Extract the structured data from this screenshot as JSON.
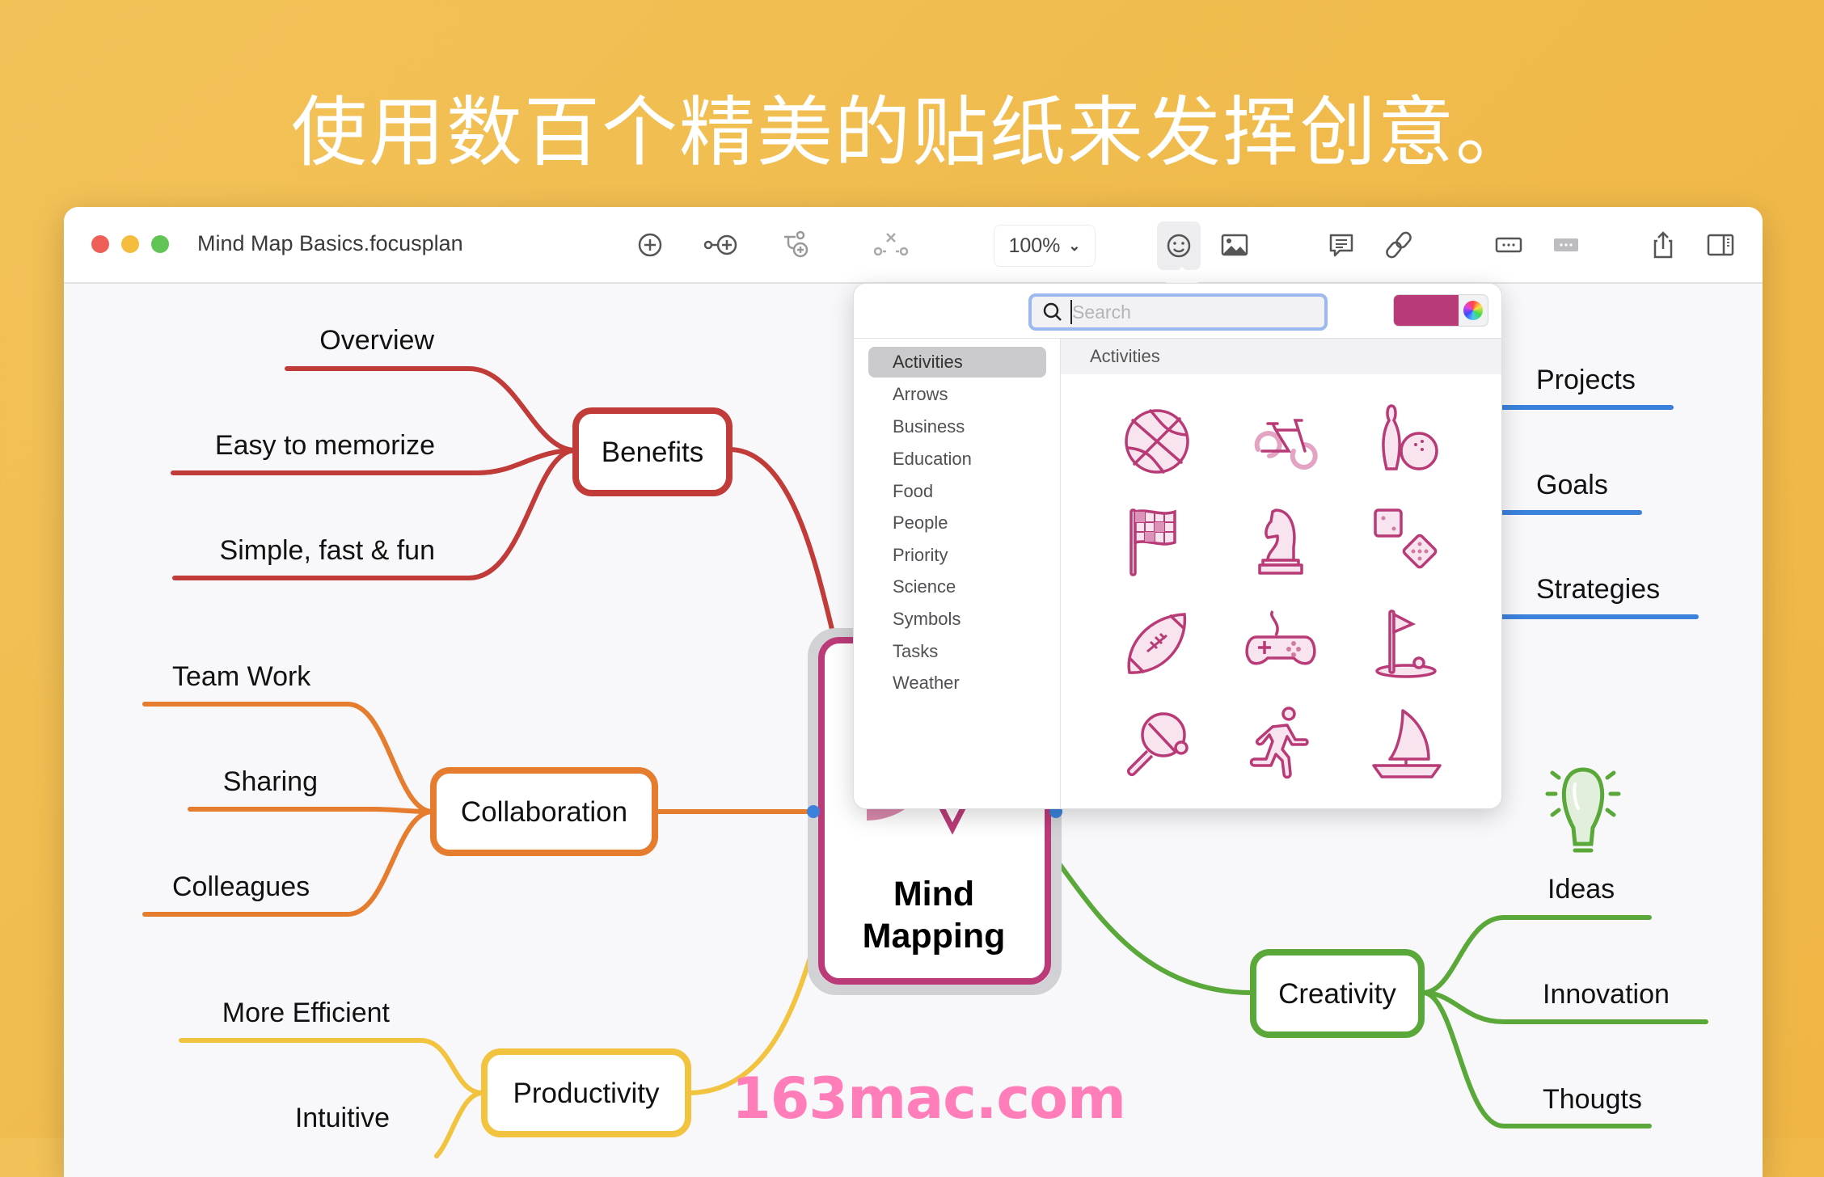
{
  "headline": "使用数百个精美的贴纸来发挥创意。",
  "window": {
    "title": "Mind Map Basics.focusplan",
    "traffic_lights": [
      "#ed5f57",
      "#f4bd3d",
      "#61c454"
    ],
    "toolbar": {
      "icons": [
        "add-topic-icon",
        "add-sibling-icon",
        "add-subtopic-icon",
        "disconnect-icon",
        "sticker-icon",
        "image-icon",
        "comment-icon",
        "link-icon",
        "more-box-icon",
        "more-filled-icon",
        "share-icon",
        "sidebar-icon"
      ],
      "zoom_level": "100%"
    }
  },
  "sticker_popover": {
    "search_placeholder": "Search",
    "search_value": "",
    "selected_color": "#b83a76",
    "categories": [
      "Activities",
      "Arrows",
      "Business",
      "Education",
      "Food",
      "People",
      "Priority",
      "Science",
      "Symbols",
      "Tasks",
      "Weather"
    ],
    "selected_category": "Activities",
    "section_title": "Activities",
    "stickers": [
      "basketball",
      "bicycle",
      "bowling",
      "checkered-flag",
      "chess-knight",
      "dice",
      "football",
      "game-controller",
      "golf",
      "ping-pong",
      "runner",
      "sailboat"
    ]
  },
  "mindmap": {
    "central": {
      "line1": "Mind",
      "line2": "Mapping",
      "color": "#bb3b78"
    },
    "branches": [
      {
        "label": "Benefits",
        "color": "#c13b38",
        "children": [
          "Overview",
          "Easy to memorize",
          "Simple, fast & fun"
        ]
      },
      {
        "label": "Collaboration",
        "color": "#e57c2e",
        "children": [
          "Team Work",
          "Sharing",
          "Colleagues"
        ]
      },
      {
        "label": "Productivity",
        "color": "#f1c33e",
        "children": [
          "More Efficient",
          "Intuitive"
        ]
      },
      {
        "label": "Creativity",
        "color": "#5ba83a",
        "children": [
          "Ideas",
          "Innovation",
          "Thougts"
        ]
      },
      {
        "label": "",
        "color": "#3b82dc",
        "children": [
          "Projects",
          "Goals",
          "Strategies"
        ]
      }
    ]
  },
  "watermark": "163mac.com"
}
